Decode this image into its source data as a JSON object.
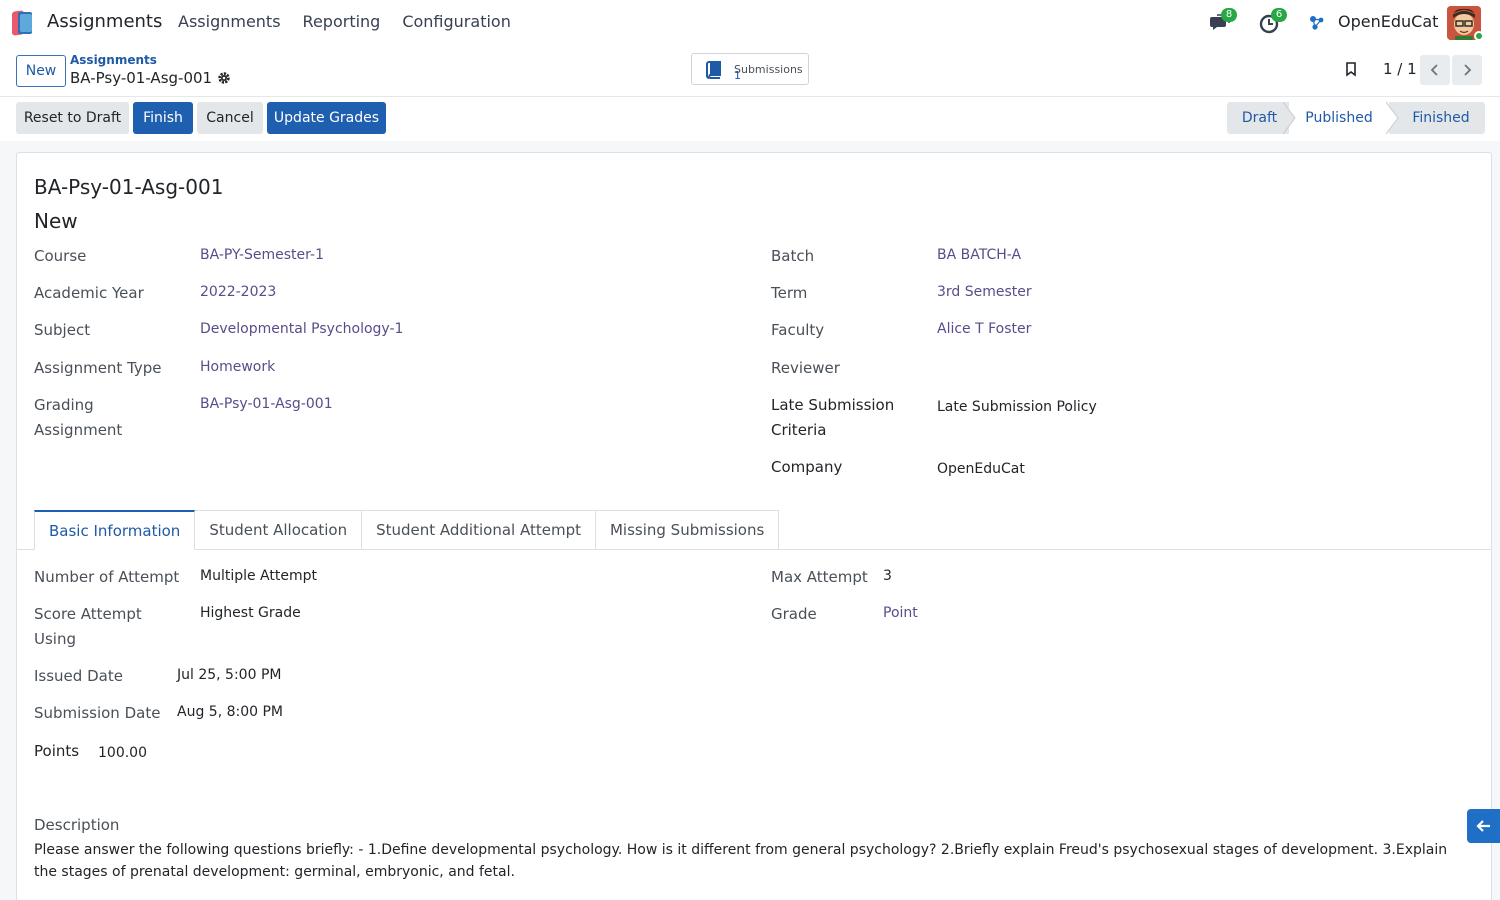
{
  "navbar": {
    "brand": "Assignments",
    "menu": [
      "Assignments",
      "Reporting",
      "Configuration"
    ],
    "messages_count": "8",
    "activities_count": "6",
    "company": "OpenEduCat"
  },
  "control": {
    "new_label": "New",
    "breadcrumb": "Assignments",
    "record_name": "BA-Psy-01-Asg-001",
    "smart_button": {
      "label": "Submissions",
      "count": "1"
    },
    "pager": "1 / 1"
  },
  "actions": {
    "reset": "Reset to Draft",
    "finish": "Finish",
    "cancel": "Cancel",
    "update": "Update Grades"
  },
  "status": {
    "stages": [
      "Draft",
      "Published",
      "Finished"
    ],
    "active": "Published"
  },
  "form": {
    "title": "BA-Psy-01-Asg-001",
    "subtitle": "New",
    "left": {
      "course": {
        "label": "Course",
        "value": "BA-PY-Semester-1"
      },
      "academic_year": {
        "label": "Academic Year",
        "value": "2022-2023"
      },
      "subject": {
        "label": "Subject",
        "value": "Developmental Psychology-1"
      },
      "assignment_type": {
        "label": "Assignment Type",
        "value": "Homework"
      },
      "grading_line1": "Grading",
      "grading_line2": "Assignment",
      "grading_value": "BA-Psy-01-Asg-001"
    },
    "right": {
      "batch": {
        "label": "Batch",
        "value": "BA BATCH-A"
      },
      "term": {
        "label": "Term",
        "value": "3rd Semester"
      },
      "faculty": {
        "label": "Faculty",
        "value": "Alice T Foster"
      },
      "reviewer": {
        "label": "Reviewer",
        "value": ""
      },
      "late_line1": "Late Submission",
      "late_line2": "Criteria",
      "late_value": "Late Submission Policy",
      "company": {
        "label": "Company",
        "value": "OpenEduCat"
      }
    }
  },
  "tabs": [
    "Basic Information",
    "Student Allocation",
    "Student Additional Attempt",
    "Missing Submissions"
  ],
  "basic": {
    "attempt": {
      "label": "Number of Attempt",
      "value": "Multiple Attempt"
    },
    "score_line1": "Score Attempt",
    "score_line2": "Using",
    "score_value": "Highest Grade",
    "issued": {
      "label": "Issued Date",
      "value": "Jul 25, 5:00 PM"
    },
    "submission": {
      "label": "Submission Date",
      "value": "Aug 5, 8:00 PM"
    },
    "points": {
      "label": "Points",
      "value": "100.00"
    },
    "max_attempt": {
      "label": "Max Attempt",
      "value": "3"
    },
    "grade": {
      "label": "Grade",
      "value": "Point"
    },
    "description_label": "Description",
    "description": "Please answer the following questions briefly: - 1.Define developmental psychology. How is it different from general psychology? 2.Briefly explain Freud's psychosexual stages of development. 3.Explain the stages of prenatal development: germinal, embryonic, and fetal."
  }
}
